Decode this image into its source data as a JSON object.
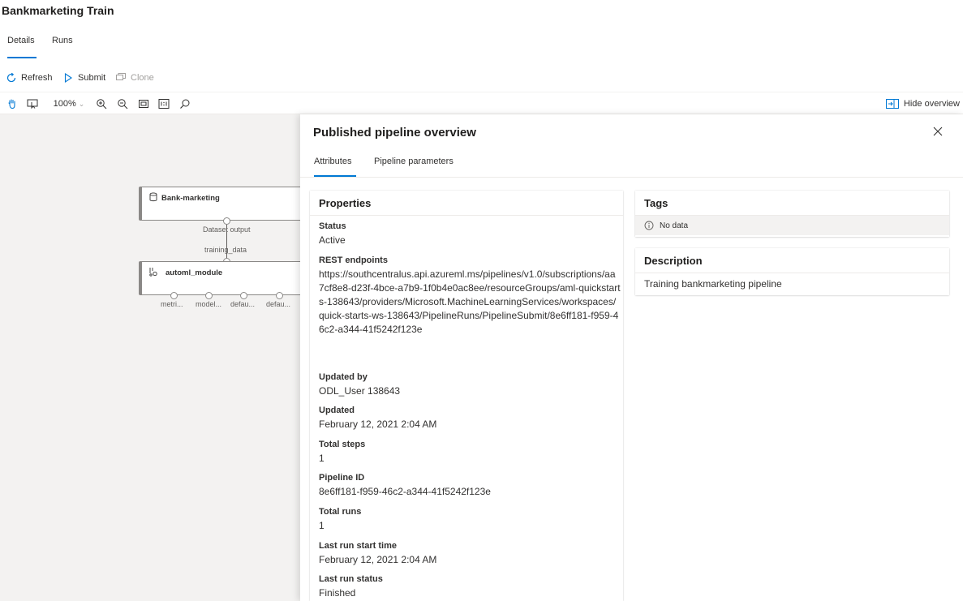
{
  "page": {
    "title": "Bankmarketing Train"
  },
  "tabs": [
    {
      "label": "Details",
      "active": true
    },
    {
      "label": "Runs",
      "active": false
    }
  ],
  "toolbar": {
    "refresh": "Refresh",
    "submit": "Submit",
    "clone": "Clone"
  },
  "canvas_toolbar": {
    "zoom": "100%",
    "hide_overview": "Hide overview"
  },
  "graph": {
    "dataset_node": {
      "label": "Bank-marketing",
      "output_label": "Dataset output"
    },
    "module_node": {
      "label": "automl_module",
      "input_label": "training_data",
      "outputs": [
        "metri...",
        "model...",
        "defau...",
        "defau..."
      ]
    }
  },
  "panel": {
    "title": "Published pipeline overview",
    "tabs": [
      {
        "label": "Attributes",
        "active": true
      },
      {
        "label": "Pipeline parameters",
        "active": false
      }
    ],
    "properties": {
      "heading": "Properties",
      "items": [
        {
          "label": "Status",
          "value": "Active"
        },
        {
          "label": "REST endpoints",
          "value": "https://southcentralus.api.azureml.ms/pipelines/v1.0/subscriptions/aa7cf8e8-d23f-4bce-a7b9-1f0b4e0ac8ee/resourceGroups/aml-quickstarts-138643/providers/Microsoft.MachineLearningServices/workspaces/quick-starts-ws-138643/PipelineRuns/PipelineSubmit/8e6ff181-f959-46c2-a344-41f5242f123e"
        },
        {
          "label": "Updated by",
          "value": "ODL_User 138643"
        },
        {
          "label": "Updated",
          "value": "February 12, 2021 2:04 AM"
        },
        {
          "label": "Total steps",
          "value": "1"
        },
        {
          "label": "Pipeline ID",
          "value": "8e6ff181-f959-46c2-a344-41f5242f123e"
        },
        {
          "label": "Total runs",
          "value": "1"
        },
        {
          "label": "Last run start time",
          "value": "February 12, 2021 2:04 AM"
        },
        {
          "label": "Last run status",
          "value": "Finished"
        }
      ]
    },
    "tags": {
      "heading": "Tags",
      "empty_text": "No data"
    },
    "description": {
      "heading": "Description",
      "text": "Training bankmarketing pipeline"
    }
  }
}
